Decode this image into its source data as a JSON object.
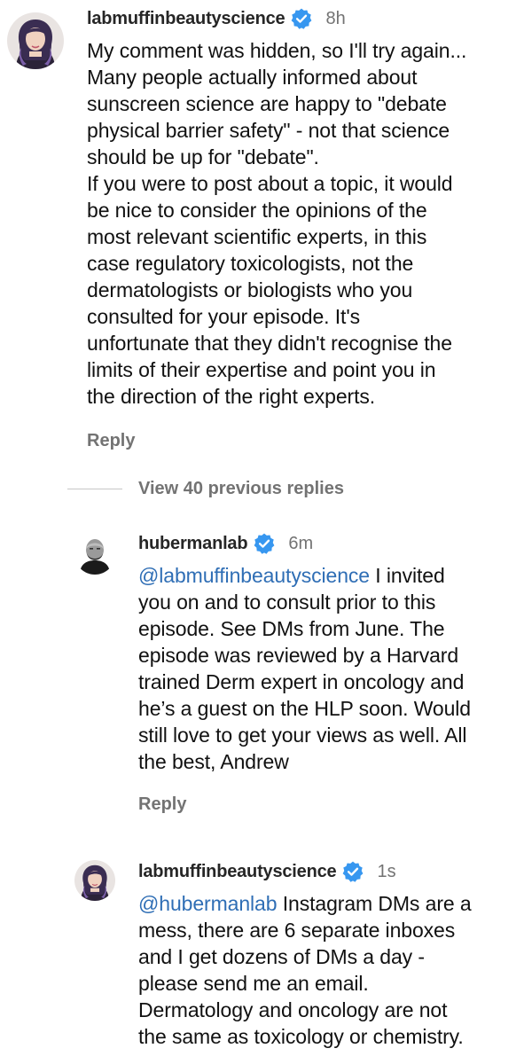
{
  "comments": [
    {
      "username": "labmuffinbeautyscience",
      "time": "8h",
      "mention": "",
      "text": "My comment was hidden, so I'll try again...\nMany people actually informed about\nsunscreen science are happy to \"debate\nphysical barrier safety\" - not that science\nshould be up for \"debate\".\nIf you were to post about a topic, it would\nbe nice to consider the opinions of the\nmost relevant scientific experts, in this\ncase regulatory toxicologists, not the\ndermatologists or biologists who you\nconsulted for your episode. It's\nunfortunate that they didn't recognise the\nlimits of their expertise and point you in\nthe direction of the right experts.",
      "reply_label": "Reply",
      "avatar_icon": "woman-portrait-avatar",
      "verified_icon": "verified-badge-icon"
    },
    {
      "username": "hubermanlab",
      "time": "6m",
      "mention": "@labmuffinbeautyscience",
      "text": " I invited\nyou on and to consult prior to this\nepisode. See DMs from June. The\nepisode was reviewed by a Harvard\ntrained Derm expert in oncology and\nhe’s a guest on the HLP soon. Would\nstill love to get your views as well. All\nthe best, Andrew",
      "reply_label": "Reply",
      "avatar_icon": "bald-man-bw-avatar",
      "verified_icon": "verified-badge-icon"
    },
    {
      "username": "labmuffinbeautyscience",
      "time": "1s",
      "mention": "@hubermanlab",
      "text": " Instagram DMs are a\nmess, there are 6 separate inboxes\nand I get dozens of DMs a day -\nplease send me an email.\nDermatology and oncology are not\nthe same as toxicology or chemistry.",
      "reply_label": "",
      "avatar_icon": "woman-portrait-avatar",
      "verified_icon": "verified-badge-icon"
    }
  ],
  "view_replies": {
    "label": "View 40 previous replies"
  },
  "colors": {
    "verified_blue": "#3797f0",
    "mention_blue": "#2f6eb5",
    "muted_gray": "#737373"
  }
}
